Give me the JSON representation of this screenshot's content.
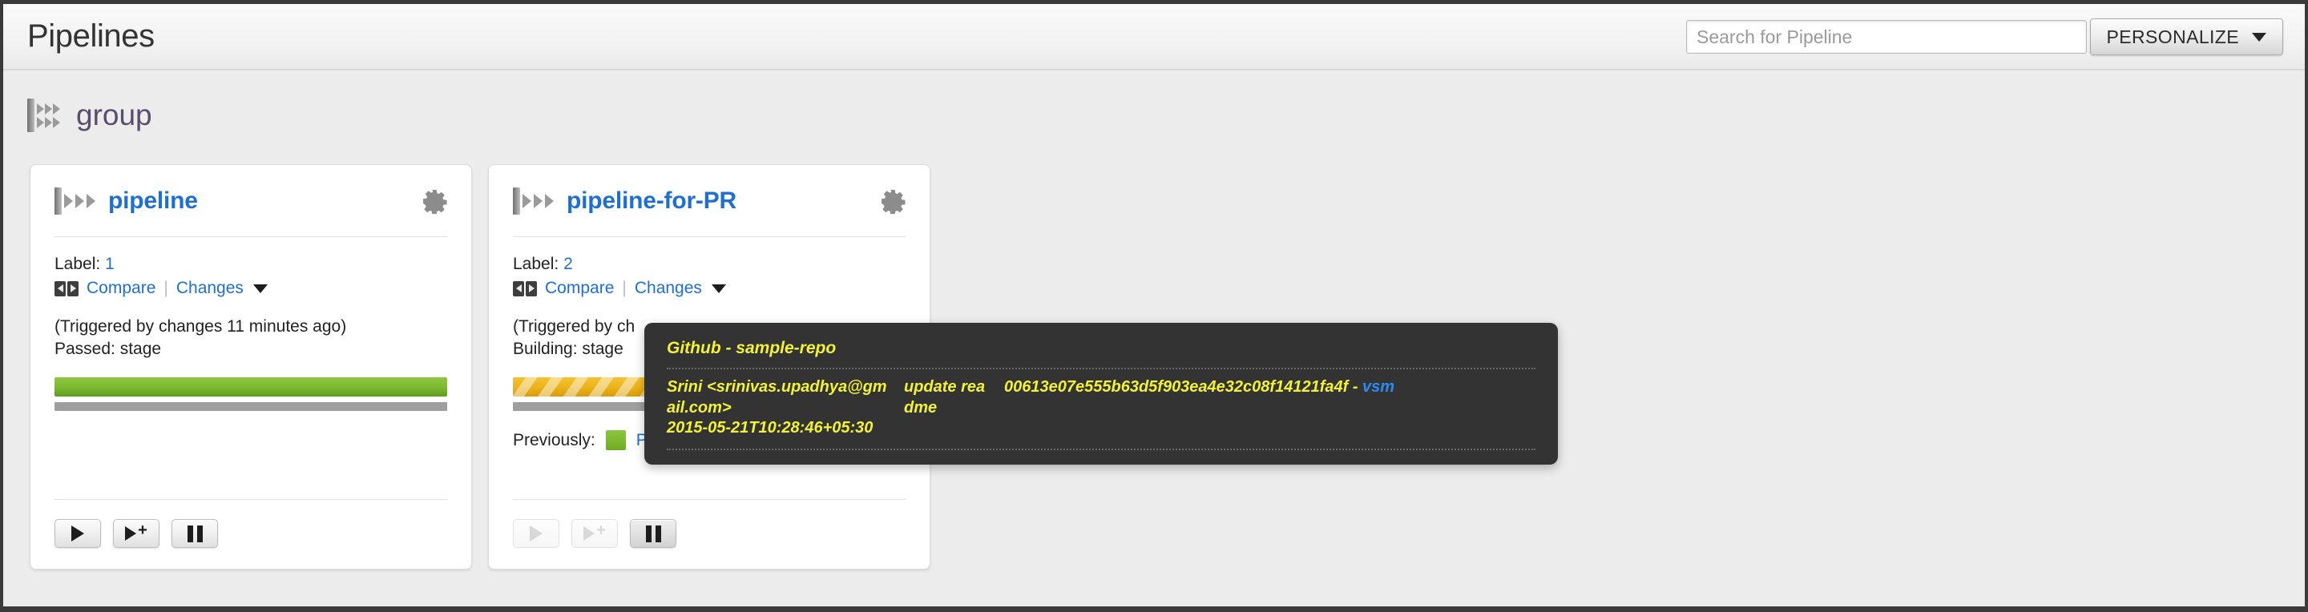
{
  "header": {
    "title": "Pipelines",
    "search_placeholder": "Search for Pipeline",
    "search_value": "",
    "personalize_label": "PERSONALIZE"
  },
  "group": {
    "name": "group",
    "icon": "pipeline-group-icon"
  },
  "pipelines": [
    {
      "name": "pipeline",
      "settings_icon": "gear-icon",
      "label_prefix": "Label:",
      "label_value": "1",
      "compare_label": "Compare",
      "compare_icon": "compare-icon",
      "changes_label": "Changes",
      "changes_caret": "chevron-down-icon",
      "trigger_text": "(Triggered by changes 11 minutes ago)",
      "status_text": "Passed: stage",
      "stage_state": "passed",
      "previously": null,
      "buttons": {
        "play": {
          "icon": "play-icon",
          "enabled": true
        },
        "play_with_options": {
          "icon": "play-plus-icon",
          "enabled": true
        },
        "pause": {
          "icon": "pause-icon",
          "enabled": true
        }
      }
    },
    {
      "name": "pipeline-for-PR",
      "settings_icon": "gear-icon",
      "label_prefix": "Label:",
      "label_value": "2",
      "compare_label": "Compare",
      "compare_icon": "compare-icon",
      "changes_label": "Changes",
      "changes_caret": "chevron-down-icon",
      "trigger_text": "(Triggered by ch",
      "status_text": "Building: stage",
      "stage_state": "building",
      "previously": {
        "prefix": "Previously:",
        "swatch_color": "#8dc63f",
        "status": "P"
      },
      "buttons": {
        "play": {
          "icon": "play-icon",
          "enabled": false
        },
        "play_with_options": {
          "icon": "play-plus-icon",
          "enabled": false
        },
        "pause": {
          "icon": "pause-icon",
          "enabled": true
        }
      }
    }
  ],
  "tooltip": {
    "title": "Github - sample-repo",
    "author": "Srini <srinivas.upadhya@gmail.com>",
    "timestamp": "2015-05-21T10:28:46+05:30",
    "comment": "update readme",
    "revision": "00613e07e555b63d5f903ea4e32c08f14121fa4f - ",
    "vsm_link": "vsm"
  },
  "colors": {
    "link": "#1f6fd0",
    "passed": "#8dc63f",
    "building": "#edb51f",
    "group_title": "#5b4b6e",
    "tooltip_bg": "#333333",
    "tooltip_text": "#f2f238"
  }
}
